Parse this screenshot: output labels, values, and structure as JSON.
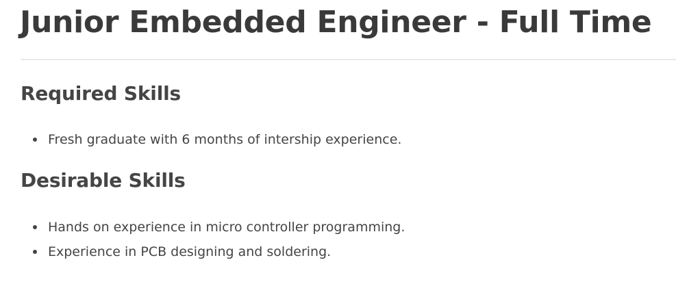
{
  "job": {
    "title": "Junior Embedded Engineer - Full Time"
  },
  "required_skills": {
    "heading": "Required Skills",
    "items": [
      "Fresh graduate with 6 months of intership experience."
    ]
  },
  "desirable_skills": {
    "heading": "Desirable Skills",
    "items": [
      "Hands on experience in micro controller programming.",
      "Experience in PCB designing and soldering."
    ]
  }
}
